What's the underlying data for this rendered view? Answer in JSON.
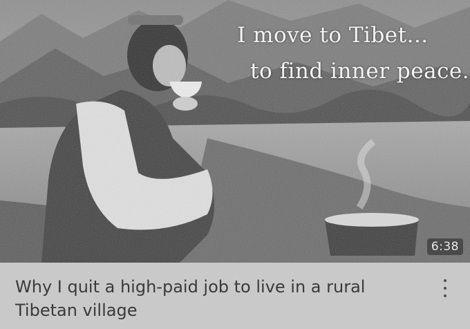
{
  "video": {
    "thumbnail_overlay_line1": "I move to Tibet...",
    "thumbnail_overlay_line2": "to find inner peace.",
    "duration": "6:38",
    "title": "Why I quit a high-paid job to live in a rural Tibetan village",
    "menu_icon": "more-vertical-icon"
  },
  "colors": {
    "page_background": "#c9c9c9",
    "title_text": "#3a3a3a",
    "duration_badge": "#4a4a4a"
  }
}
